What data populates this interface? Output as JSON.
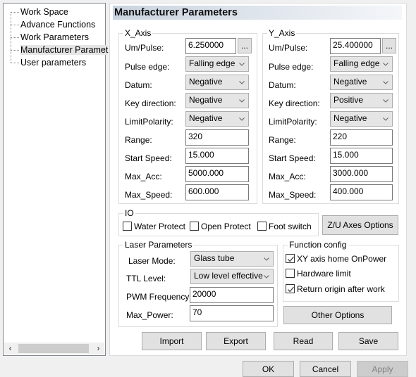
{
  "tree": {
    "items": [
      {
        "label": "Work Space"
      },
      {
        "label": "Advance Functions"
      },
      {
        "label": "Work Parameters"
      },
      {
        "label": "Manufacturer Paramet"
      },
      {
        "label": "User parameters"
      }
    ],
    "selected_index": 3
  },
  "header": {
    "title": "Manufacturer Parameters"
  },
  "x_axis": {
    "title": "X_Axis",
    "um_pulse_label": "Um/Pulse:",
    "um_pulse": "6.250000",
    "browse_label": "...",
    "pulse_edge_label": "Pulse edge:",
    "pulse_edge": "Falling edge",
    "datum_label": "Datum:",
    "datum": "Negative",
    "key_direction_label": "Key direction:",
    "key_direction": "Negative",
    "limit_polarity_label": "LimitPolarity:",
    "limit_polarity": "Negative",
    "range_label": "Range:",
    "range": "320",
    "start_speed_label": "Start Speed:",
    "start_speed": "15.000",
    "max_acc_label": "Max_Acc:",
    "max_acc": "5000.000",
    "max_speed_label": "Max_Speed:",
    "max_speed": "600.000"
  },
  "y_axis": {
    "title": "Y_Axis",
    "um_pulse_label": "Um/Pulse:",
    "um_pulse": "25.400000",
    "browse_label": "...",
    "pulse_edge_label": "Pulse edge:",
    "pulse_edge": "Falling edge",
    "datum_label": "Datum:",
    "datum": "Negative",
    "key_direction_label": "Key direction:",
    "key_direction": "Positive",
    "limit_polarity_label": "LimitPolarity:",
    "limit_polarity": "Negative",
    "range_label": "Range:",
    "range": "220",
    "start_speed_label": "Start Speed:",
    "start_speed": "15.000",
    "max_acc_label": "Max_Acc:",
    "max_acc": "3000.000",
    "max_speed_label": "Max_Speed:",
    "max_speed": "400.000"
  },
  "io": {
    "title": "IO",
    "water_protect": {
      "label": "Water Protect",
      "checked": false
    },
    "open_protect": {
      "label": "Open Protect",
      "checked": false
    },
    "foot_switch": {
      "label": "Foot switch",
      "checked": false
    }
  },
  "zu_axes_button": "Z/U Axes Options",
  "laser": {
    "title": "Laser Parameters",
    "mode_label": "Laser Mode:",
    "mode": "Glass tube",
    "ttl_label": "TTL Level:",
    "ttl": "Low level effective",
    "pwm_label": "PWM Frequency:",
    "pwm": "20000",
    "max_power_label": "Max_Power:",
    "max_power": "70"
  },
  "function_config": {
    "title": "Function config",
    "xy_home": {
      "label": "XY axis home OnPower",
      "checked": true
    },
    "hardware_limit": {
      "label": "Hardware limit",
      "checked": false
    },
    "return_origin": {
      "label": "Return origin after work",
      "checked": true
    }
  },
  "other_options_button": "Other Options",
  "actions": {
    "import": "Import",
    "export": "Export",
    "read": "Read",
    "save": "Save"
  },
  "dialog": {
    "ok": "OK",
    "cancel": "Cancel",
    "apply": "Apply"
  }
}
